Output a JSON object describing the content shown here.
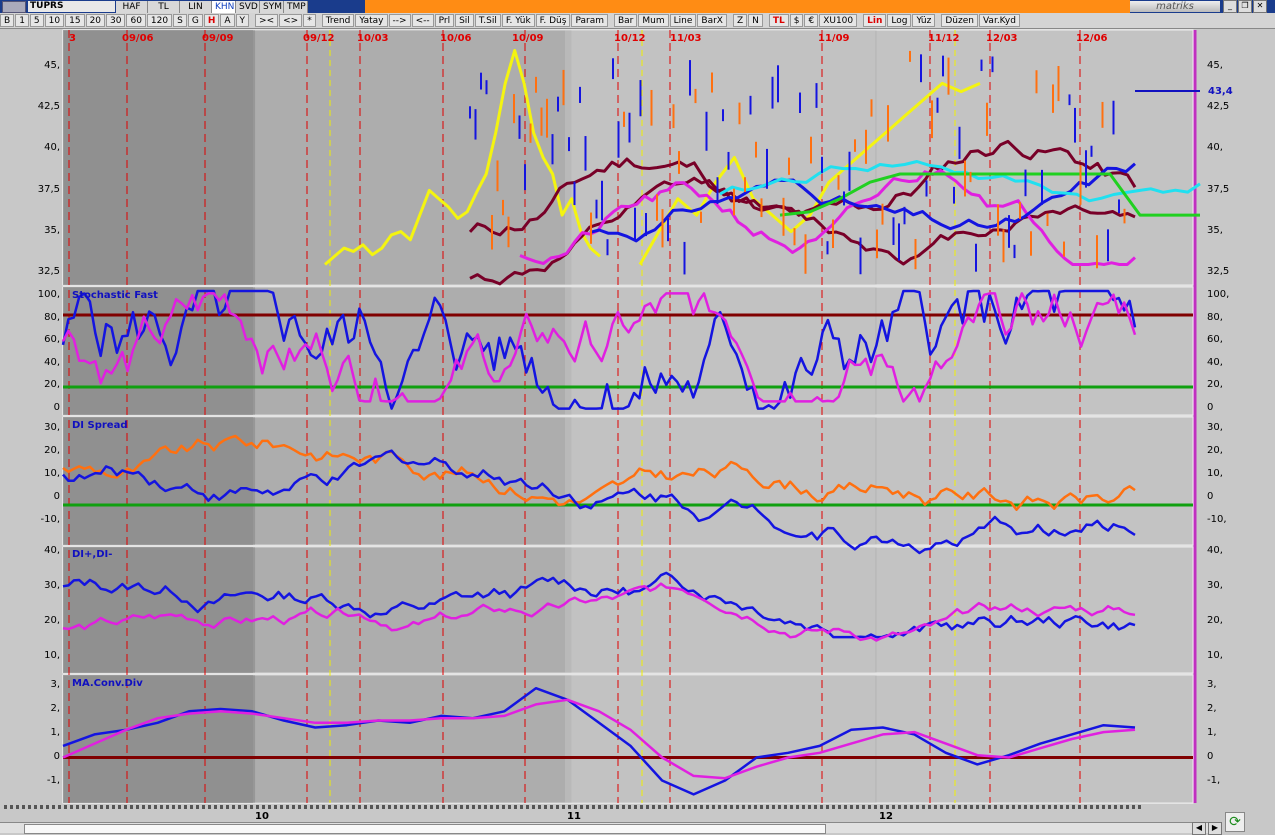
{
  "titlebar": {
    "symbol": "TUPRS",
    "tabs": [
      "HAF",
      "TL",
      "LIN",
      "KHN",
      "SVD",
      "SYM",
      "TMP"
    ],
    "active_tab": "KHN",
    "logo": "matriks"
  },
  "toolbar": {
    "periods": [
      "B",
      "1",
      "5",
      "10",
      "15",
      "20",
      "30",
      "60",
      "120",
      "S",
      "G",
      "H",
      "A",
      "Y"
    ],
    "nav": [
      "><",
      "<>",
      "*"
    ],
    "tools": [
      "Trend",
      "Yatay",
      "-->",
      "<--",
      "Prl",
      "Sil",
      "T.Sil",
      "F. Yük",
      "F. Düş",
      "Param"
    ],
    "types": [
      "Bar",
      "Mum",
      "Line",
      "BarX"
    ],
    "zn": [
      "Z",
      "N"
    ],
    "currency": [
      "TL",
      "$",
      "€",
      "XU100"
    ],
    "scale": [
      "Lin",
      "Log",
      "Yüz"
    ],
    "edit": [
      "Düzen",
      "Var.Kyd"
    ]
  },
  "dates": [
    "3",
    "09/06",
    "09/09",
    "09/12",
    "10/03",
    "10/06",
    "10/09",
    "10/12",
    "11/03",
    "11/09",
    "11/12",
    "12/03",
    "12/06"
  ],
  "months": [
    "10",
    "11",
    "12"
  ],
  "price_axis": [
    "45,",
    "42,5",
    "40,",
    "37,5",
    "35,",
    "32,5"
  ],
  "last_price": "43,4",
  "stoch": {
    "label": "Stochastic Fast",
    "axis": [
      "100,",
      "80,",
      "60,",
      "40,",
      "20,",
      "0"
    ]
  },
  "di_spread": {
    "label": "DI Spread",
    "axis": [
      "30,",
      "20,",
      "10,",
      "0",
      "-10,"
    ]
  },
  "di": {
    "label": "DI+,DI-",
    "axis": [
      "40,",
      "30,",
      "20,",
      "10,"
    ]
  },
  "macd": {
    "label": "MA.Conv.Div",
    "axis": [
      "3,",
      "2,",
      "1,",
      "0",
      "-1,"
    ]
  },
  "colors": {
    "bg_dark": "#8a8a8a",
    "bg_light": "#d8d8d8",
    "blue": "#1414e0",
    "magenta": "#e020e0",
    "yellow": "#f4f410",
    "cyan": "#20e0f0",
    "green": "#20d020",
    "maroon": "#780028",
    "orange": "#ff7010"
  }
}
